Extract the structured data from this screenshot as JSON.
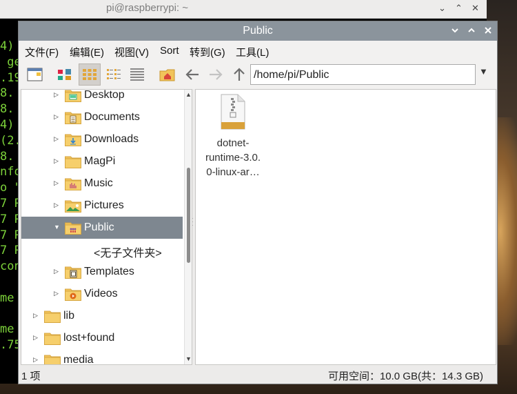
{
  "terminal": {
    "title": "pi@raspberrypi: ~",
    "lines": [
      "4)",
      " ge",
      ".19",
      "8.",
      "8.",
      "4)",
      "(2.",
      "8.",
      "nfo",
      "o \"",
      "7 P",
      "7 P",
      "7 P",
      "7 P",
      "con",
      "",
      "me",
      "",
      "me",
      ".75"
    ]
  },
  "window": {
    "title": "Public",
    "controls": {
      "minimize": "⌄",
      "maximize": "⌃",
      "close": "×"
    }
  },
  "menubar": {
    "file": "文件(F)",
    "edit": "编辑(E)",
    "view": "视图(V)",
    "sort": "Sort",
    "go": "转到(G)",
    "tools": "工具(L)"
  },
  "toolbar": {
    "path": "/home/pi/Public"
  },
  "sidebar": {
    "items": [
      {
        "label": "Desktop"
      },
      {
        "label": "Documents"
      },
      {
        "label": "Downloads"
      },
      {
        "label": "MagPi"
      },
      {
        "label": "Music"
      },
      {
        "label": "Pictures"
      },
      {
        "label": "Public"
      },
      {
        "label": "<无子文件夹>"
      },
      {
        "label": "Templates"
      },
      {
        "label": "Videos"
      },
      {
        "label": "lib"
      },
      {
        "label": "lost+found"
      },
      {
        "label": "media"
      }
    ]
  },
  "files": [
    {
      "name_line1": "dotnet-",
      "name_line2": "runtime-3.0.",
      "name_line3": "0-linux-ar…",
      "icon": "archive-icon"
    }
  ],
  "status": {
    "count": "1 项",
    "free_space": "可用空间：10.0 GB(共：14.3 GB)"
  },
  "colors": {
    "titlebar": "#8b949c",
    "selection": "#7e8790",
    "terminal_text": "#7cd13a",
    "folder": "#f1c35a"
  }
}
